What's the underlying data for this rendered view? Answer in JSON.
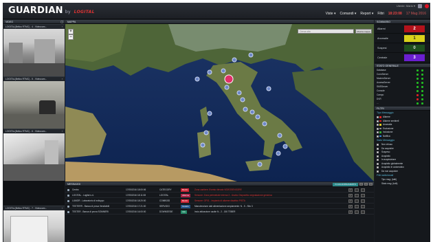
{
  "app": {
    "name": "GUARDIAN",
    "by": "by",
    "brand": "LOGITAL",
    "user": "Utente: Mario ▾",
    "menu": [
      "Viste ▾",
      "Comandi ▾",
      "Report ▾",
      "Filtri"
    ],
    "time": "18:23:08",
    "date": "17 Mag 2016"
  },
  "video": {
    "title": "VIDEO",
    "cams": [
      "LOGITAL(Bellus RTMC) - 4 - Videocam...",
      "LOGITAL(Bellus RTMC) - 5 - Videocam...",
      "LOGITAL(Bellus RTMC) - 6 - Videocam...",
      "LOGITAL(Bellus RTMC) - 7 - Videocam..."
    ]
  },
  "map": {
    "title": "MAPPA",
    "search_placeholder": "Cerca sito",
    "search_button": "Mostra mappa"
  },
  "messages": {
    "title": "MESSAGGI",
    "tab": "IN AGGIORNAMENTO",
    "rows": [
      {
        "site": "Centro",
        "time": "17/05/2016 18:00:06",
        "cat": "CATEGORY",
        "badge": "BLOC",
        "text": "Zona cantiere: Evento rilevato VIDEOSENSORE",
        "color": "#c23",
        "textcolor": "#d33"
      },
      {
        "site": "LOGITAL - Logital s.r.l.",
        "time": "17/05/2016 18:11:08",
        "cat": "LOGITAL",
        "badge": "Allarme",
        "text": "Sensore: Zona perimetrale interna 3 - Uscita: Dispositivo segnalazione generica",
        "color": "#a24",
        "textcolor": "#d33"
      },
      {
        "site": "LUMOR - Laboratorio di sviluppo",
        "time": "17/05/2016 18:20:00",
        "cat": "COMBOID",
        "badge": "BLOC",
        "text": "Sensore: GF01 - Impianto di allarme disattivo PISTA",
        "color": "#c23",
        "textcolor": "#d33"
      },
      {
        "site": "TESTERR - Banca di prova Vendicibili",
        "time": "17/05/2016 17:21:00",
        "cat": "SERVIZIO",
        "badge": "Guasto",
        "text": "Manutenzione dati alimentazione ampiamente: N - 5 - Sito 3",
        "color": "#258",
        "textcolor": "#cfd6de"
      },
      {
        "site": "TESTER - Banca di prova SOMMERI",
        "time": "17/05/2016 16:00:00",
        "cat": "DOWNSESIE",
        "badge": "Info",
        "text": "Invio attivazione uscite N - 2 - 150 TEBER",
        "color": "#286",
        "textcolor": "#cfd6de"
      }
    ]
  },
  "summary": {
    "title": "SOMMARIO",
    "rows": [
      {
        "label": "Allarmi",
        "value": "2",
        "bg": "#b3121b",
        "fg": "#ffffff"
      },
      {
        "label": "Anomalie",
        "value": "1",
        "bg": "#d9d21a",
        "fg": "#222222"
      },
      {
        "label": "Sospesi",
        "value": "0",
        "bg": "#1e4f1e",
        "fg": "#dddddd"
      },
      {
        "label": "Centrale",
        "value": "3",
        "bg": "#6a1fd0",
        "fg": "#ffffff"
      }
    ]
  },
  "status": {
    "title": "STATO GENERALE",
    "rows": [
      "Database",
      "ConnServer",
      "ModemServer",
      "AccessServer",
      "SMSServer",
      "Console",
      "Campo",
      "DVR",
      "..."
    ]
  },
  "filters": {
    "title": "FILTRI",
    "types_title": "Tipo Messaggio",
    "types": [
      {
        "label": "Allarme",
        "color": "#d22"
      },
      {
        "label": "Allarme sentinell",
        "color": "#d22"
      },
      {
        "label": "Anomalia",
        "color": "#dc2"
      },
      {
        "label": "Esclusione",
        "color": "#888"
      },
      {
        "label": "Inclusione",
        "color": "#3a3"
      },
      {
        "label": "Notifica",
        "color": "#38d"
      }
    ],
    "state_title": "Stato Messaggio",
    "states": [
      "Non chiuso",
      "Da acquisire",
      "Sospeso",
      "Acquisito",
      "In acquisizione",
      "Acquisito globalmente",
      "Acquisito in automatico",
      "Da non acquisire"
    ],
    "extra_title": "Filtri addizionali",
    "extras": [
      "Tipo msg: (tutti)",
      "Stato msg: (tutti)"
    ]
  }
}
